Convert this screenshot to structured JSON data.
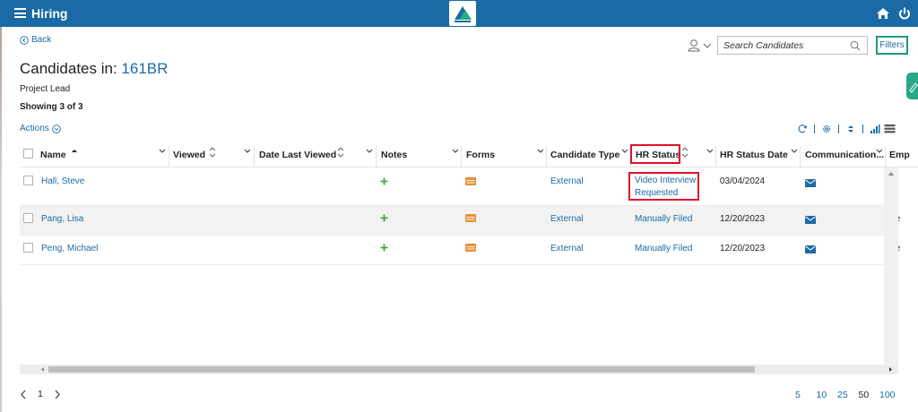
{
  "app": {
    "title": "Hiring"
  },
  "nav": {
    "back_label": "Back",
    "search_placeholder": "Search Candidates",
    "filters_label": "Filters"
  },
  "header": {
    "title_prefix": "Candidates in:",
    "requisition": "161BR",
    "subtitle": "Project Lead",
    "showing": "Showing 3 of 3",
    "actions_label": "Actions"
  },
  "columns": [
    "Name",
    "Viewed",
    "Date Last Viewed",
    "Notes",
    "Forms",
    "Candidate Type",
    "HR Status",
    "HR Status Date",
    "Communication...",
    "Emp"
  ],
  "rows": [
    {
      "name": "Hall, Steve",
      "candidate_type": "External",
      "hr_status_line1": "Video Interview",
      "hr_status_line2": "Requested",
      "hr_status_date": "03/04/2024",
      "emp": ""
    },
    {
      "name": "Pang, Lisa",
      "candidate_type": "External",
      "hr_status_line1": "Manually Filed",
      "hr_status_line2": "",
      "hr_status_date": "12/20/2023",
      "emp": "Se"
    },
    {
      "name": "Peng, Michael",
      "candidate_type": "External",
      "hr_status_line1": "Manually Filed",
      "hr_status_line2": "",
      "hr_status_date": "12/20/2023",
      "emp": "Se"
    }
  ],
  "pagination": {
    "current_page": "1",
    "page_sizes": [
      "5",
      "10",
      "25",
      "50",
      "100"
    ],
    "selected_size": "50"
  },
  "colors": {
    "brand": "#1c6aa5",
    "accent_green": "#2aa787",
    "highlight_red": "#e0102a",
    "notes_plus": "#3cae3c",
    "forms_icon": "#e69135"
  }
}
